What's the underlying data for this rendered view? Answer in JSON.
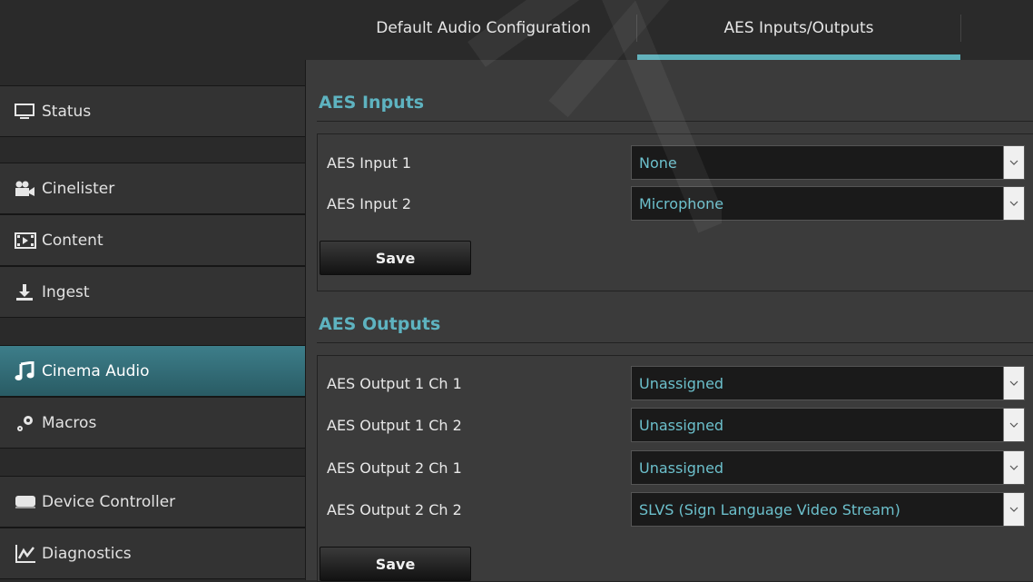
{
  "tabs": [
    {
      "label": "Default Audio Configuration",
      "active": false
    },
    {
      "label": "AES Inputs/Outputs",
      "active": true
    }
  ],
  "sidebar": {
    "items": [
      {
        "label": "Status",
        "icon": "monitor-icon"
      },
      {
        "label": "Cinelister",
        "icon": "camera-icon"
      },
      {
        "label": "Content",
        "icon": "film-icon"
      },
      {
        "label": "Ingest",
        "icon": "download-icon"
      },
      {
        "label": "Cinema Audio",
        "icon": "music-note-icon",
        "active": true
      },
      {
        "label": "Macros",
        "icon": "gears-icon"
      },
      {
        "label": "Device Controller",
        "icon": "device-icon"
      },
      {
        "label": "Diagnostics",
        "icon": "chart-icon"
      }
    ]
  },
  "aes_inputs": {
    "title": "AES Inputs",
    "rows": [
      {
        "label": "AES Input 1",
        "value": "None"
      },
      {
        "label": "AES Input 2",
        "value": "Microphone"
      }
    ],
    "save_label": "Save"
  },
  "aes_outputs": {
    "title": "AES Outputs",
    "rows": [
      {
        "label": "AES Output 1 Ch 1",
        "value": "Unassigned"
      },
      {
        "label": "AES Output 1 Ch 2",
        "value": "Unassigned"
      },
      {
        "label": "AES Output 2 Ch 1",
        "value": "Unassigned"
      },
      {
        "label": "AES Output 2 Ch 2",
        "value": "SLVS (Sign Language Video Stream)"
      }
    ],
    "save_label": "Save"
  },
  "colors": {
    "accent": "#5eb3c0",
    "active_nav": "#3d7e8a",
    "select_text": "#6cc0cc"
  }
}
